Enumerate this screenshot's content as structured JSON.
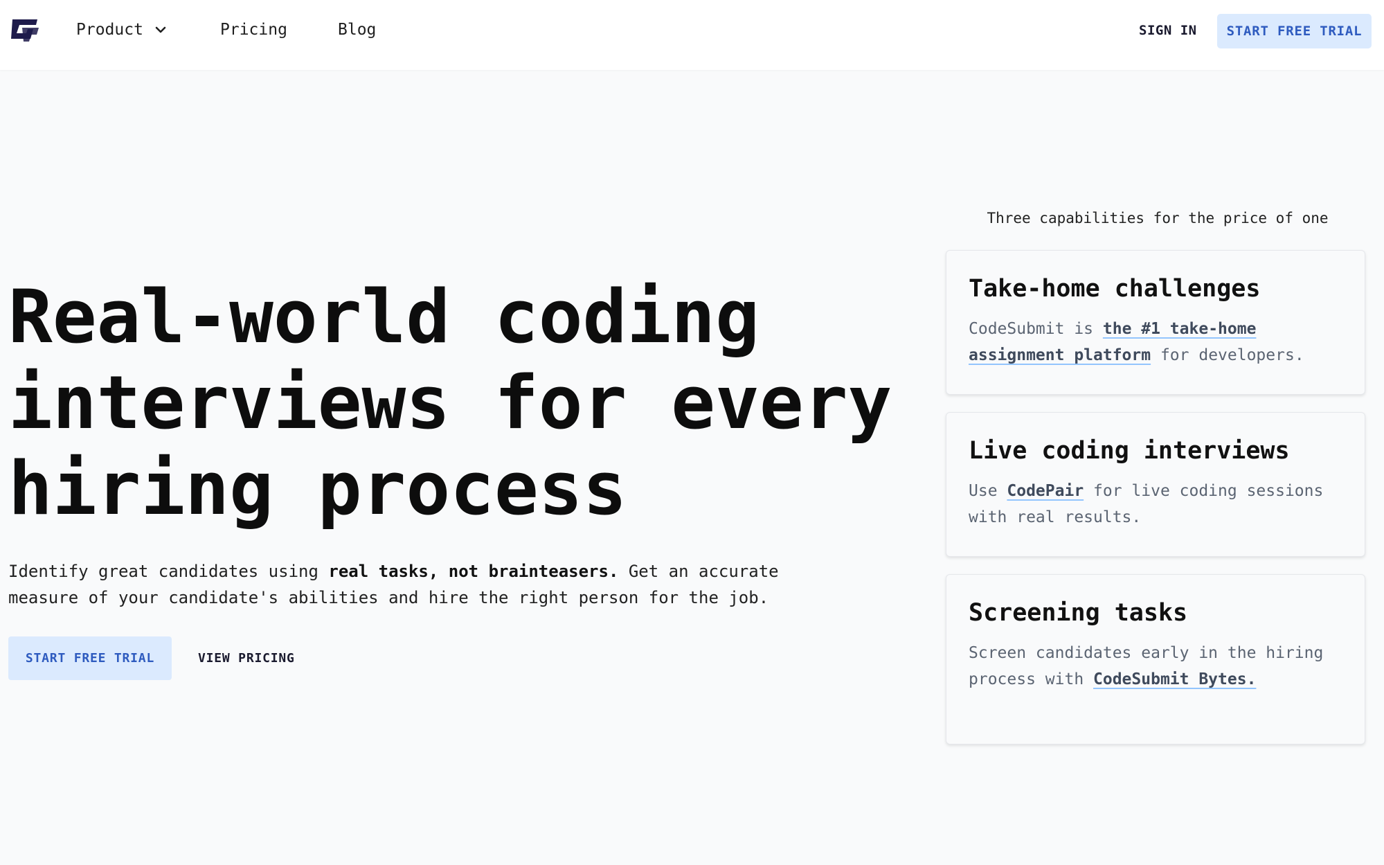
{
  "header": {
    "nav": {
      "product_label": "Product",
      "pricing_label": "Pricing",
      "blog_label": "Blog"
    },
    "sign_in_label": "SIGN IN",
    "trial_label": "START FREE TRIAL"
  },
  "hero": {
    "title_line1": "Real-world coding",
    "title_line2": "interviews for every",
    "title_line3": "hiring process",
    "desc_part1": "Identify great candidates using ",
    "desc_bold": "real tasks, not brainteasers.",
    "desc_part2": " Get an accurate measure of your candidate's abilities and hire the right person for the job.",
    "primary_button": "START FREE TRIAL",
    "secondary_button": "VIEW PRICING"
  },
  "capabilities": {
    "heading": "Three capabilities for the price of one",
    "cards": [
      {
        "title": "Take-home challenges",
        "text_before": "CodeSubmit is ",
        "link": "the #1 take-home assignment platform",
        "text_after": " for developers."
      },
      {
        "title": "Live coding interviews",
        "text_before": "Use ",
        "link": "CodePair",
        "text_after": " for live coding sessions with real results."
      },
      {
        "title": "Screening tasks",
        "text_before": "Screen candidates early in the hiring process with ",
        "link": "CodeSubmit Bytes.",
        "text_after": ""
      }
    ]
  },
  "colors": {
    "background": "#f9fafb",
    "accent_bg": "#dbeafe",
    "accent_text": "#2e5bbf",
    "logo": "#1e1b4b",
    "link_underline": "#93c5fd"
  },
  "icons": {
    "logo": "codesubmit-logo-icon",
    "dropdown": "chevron-down-icon"
  }
}
